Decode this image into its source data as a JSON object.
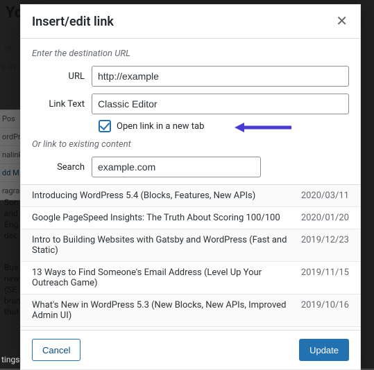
{
  "dialog": {
    "title": "Insert/edit link",
    "hint": "Enter the destination URL",
    "url_label": "URL",
    "url_value": "http://example",
    "linktext_label": "Link Text",
    "linktext_value": "Classic Editor",
    "open_new_tab_label": "Open link in a new tab",
    "open_new_tab_checked": true,
    "existing_hint": "Or link to existing content",
    "search_label": "Search",
    "search_value": "example.com",
    "cancel_label": "Cancel",
    "update_label": "Update"
  },
  "results": [
    {
      "title": "Introducing WordPress 5.4 (Blocks, Features, New APIs)",
      "date": "2020/03/11"
    },
    {
      "title": "Google PageSpeed Insights: The Truth About Scoring 100/100",
      "date": "2020/01/20"
    },
    {
      "title": "Intro to Building Websites with Gatsby and WordPress (Fast and Static)",
      "date": "2019/12/23"
    },
    {
      "title": "13 Ways to Find Someone's Email Address (Level Up Your Outreach Game)",
      "date": "2019/11/15"
    },
    {
      "title": "What's New in WordPress 5.3 (New Blocks, New APIs, Improved Admin UI)",
      "date": "2019/10/16"
    }
  ],
  "background": {
    "heading_fragment": "Yo",
    "line1": "or",
    "line2": "e in",
    "sidebar": [
      "Pos",
      "ordPr",
      "nalinks",
      "dd M",
      "ragraph"
    ],
    "body1": "Son and Eng dec",
    "body2": "Bus new (SE bran that",
    "footer": "tings"
  }
}
